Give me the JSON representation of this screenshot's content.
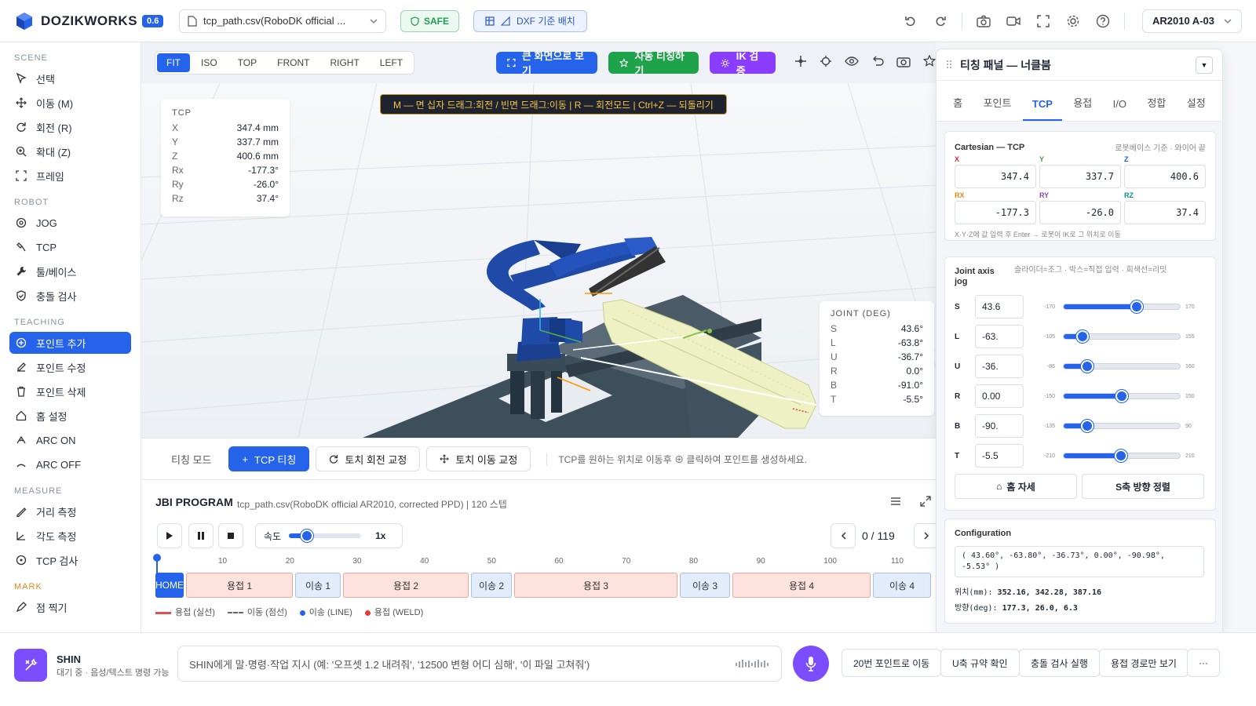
{
  "app": {
    "name": "DOZIKWORKS",
    "version": "0.6"
  },
  "topbar": {
    "file_name": "tcp_path.csv(RoboDK official ...",
    "safe_label": "SAFE",
    "dxf_label": "DXF 기준 배치",
    "robot_selector": "AR2010 A-03"
  },
  "sidebar": {
    "scene_title": "SCENE",
    "scene_items": [
      "선택",
      "이동 (M)",
      "회전 (R)",
      "확대 (Z)",
      "프레임"
    ],
    "robot_title": "ROBOT",
    "robot_items": [
      "JOG",
      "TCP",
      "툴/베이스",
      "충돌 검사"
    ],
    "teaching_title": "TEACHING",
    "teaching_items": [
      "포인트 추가",
      "포인트 수정",
      "포인트 삭제",
      "홈 설정",
      "ARC ON",
      "ARC OFF"
    ],
    "measure_title": "MEASURE",
    "measure_items": [
      "거리 측정",
      "각도 측정",
      "TCP 검사"
    ],
    "mark_title": "MARK",
    "mark_items": [
      "점 찍기"
    ]
  },
  "viewport": {
    "views": [
      "FIT",
      "ISO",
      "TOP",
      "FRONT",
      "RIGHT",
      "LEFT"
    ],
    "fullscreen_label": "큰 화면으로 보기",
    "auto_teach_label": "자동 티칭하기",
    "ik_label": "IK 검증",
    "hint": "M — 면 십자 드래그:회전 / 빈면 드래그:이동 | R — 회전모드 | Ctrl+Z — 되돌리기",
    "tcp_title": "TCP",
    "tcp": [
      {
        "k": "X",
        "v": "347.4 mm"
      },
      {
        "k": "Y",
        "v": "337.7 mm"
      },
      {
        "k": "Z",
        "v": "400.6 mm"
      },
      {
        "k": "Rx",
        "v": "-177.3°"
      },
      {
        "k": "Ry",
        "v": "-26.0°"
      },
      {
        "k": "Rz",
        "v": "37.4°"
      }
    ],
    "joint_title": "JOINT (DEG)",
    "joints": [
      {
        "k": "S",
        "v": "43.6°"
      },
      {
        "k": "L",
        "v": "-63.8°"
      },
      {
        "k": "U",
        "v": "-36.7°"
      },
      {
        "k": "R",
        "v": "0.0°"
      },
      {
        "k": "B",
        "v": "-91.0°"
      },
      {
        "k": "T",
        "v": "-5.5°"
      }
    ]
  },
  "teaching_mode": {
    "label": "티칭 모드",
    "tcp_teach": "TCP 티칭",
    "rot_fix": "토치 회전 교정",
    "move_fix": "토치 이동 교정",
    "hint": "TCP를 원하는 위치로 이동후 ⊕ 클릭하여 포인트를 생성하세요."
  },
  "program": {
    "title": "JBI PROGRAM",
    "subtitle": "tcp_path.csv(RoboDK official AR2010, corrected PPD) | 120 스텝",
    "speed_label": "속도",
    "speed_value": "1x",
    "speed_fraction": 0.25,
    "counter": "0 / 119",
    "ticks": [
      "10",
      "20",
      "30",
      "40",
      "50",
      "60",
      "70",
      "80",
      "90",
      "100",
      "110"
    ],
    "segments": [
      {
        "label": "HOME",
        "kind": "home"
      },
      {
        "label": "용접 1",
        "kind": "weld"
      },
      {
        "label": "이송 1",
        "kind": "move"
      },
      {
        "label": "용접 2",
        "kind": "weld"
      },
      {
        "label": "이송 2",
        "kind": "move"
      },
      {
        "label": "용접 3",
        "kind": "weld"
      },
      {
        "label": "이송 3",
        "kind": "move"
      },
      {
        "label": "용접 4",
        "kind": "weld"
      },
      {
        "label": "이송 4",
        "kind": "move"
      }
    ],
    "legend": [
      "용접 (실선)",
      "이동 (점선)",
      "이송 (LINE)",
      "용접 (WELD)"
    ]
  },
  "panel": {
    "title": "티칭 패널 — 너클붐",
    "tabs": [
      "홈",
      "포인트",
      "TCP",
      "용접",
      "I/O",
      "정합",
      "설정"
    ],
    "active_tab": "TCP",
    "cart_title": "Cartesian — TCP",
    "cart_note": "로봇베이스 기준 · 와이어 끝",
    "cart": [
      {
        "k": "X",
        "v": "347.4",
        "c": "#d32f2f"
      },
      {
        "k": "Y",
        "v": "337.7",
        "c": "#43a047"
      },
      {
        "k": "Z",
        "v": "400.6",
        "c": "#1e63d6"
      },
      {
        "k": "RX",
        "v": "-177.3",
        "c": "#e08a1e"
      },
      {
        "k": "RY",
        "v": "-26.0",
        "c": "#8e44ad"
      },
      {
        "k": "RZ",
        "v": "37.4",
        "c": "#0f8a8a"
      }
    ],
    "cart_help": "X·Y·Z에 값 입력 후 Enter → 로봇이 IK로 그 위치로 이동",
    "jog_title": "Joint axis jog",
    "jog_note": "슬라이더=조그 · 박스=직접 입력 · 회색선=리밋",
    "jog": [
      {
        "k": "S",
        "v": "43.6",
        "min": "-170",
        "max": "170",
        "frac": 0.63
      },
      {
        "k": "L",
        "v": "-63.",
        "min": "-105",
        "max": "155",
        "frac": 0.16
      },
      {
        "k": "U",
        "v": "-36.",
        "min": "-86",
        "max": "160",
        "frac": 0.2
      },
      {
        "k": "R",
        "v": "0.00",
        "min": "-150",
        "max": "150",
        "frac": 0.5
      },
      {
        "k": "B",
        "v": "-90.",
        "min": "-135",
        "max": "90",
        "frac": 0.2
      },
      {
        "k": "T",
        "v": "-5.5",
        "min": "-210",
        "max": "210",
        "frac": 0.49
      }
    ],
    "home_pose": "홈 자세",
    "s_axis_align": "S축 방향 정렬",
    "config_title": "Configuration",
    "config_value": "( 43.60°, -63.80°, -36.73°, 0.00°, -90.98°, -5.53° )",
    "pos_label": "위치(mm):",
    "pos_value": "352.16, 342.28, 387.16",
    "dir_label": "방향(deg):",
    "dir_value": "177.3, 26.0, 6.3"
  },
  "assistant": {
    "name": "SHIN",
    "status": "대기 중 · 음성/텍스트 명령 가능",
    "placeholder": "SHIN에게 말·명령·작업 지시 (예: '오프셋 1.2 내려줘', '12500 변형 어디 심해', '이 파일 고쳐줘')",
    "quick": [
      "20번 포인트로 이동",
      "U축 규약 확인",
      "충돌 검사 실행",
      "용접 경로만 보기",
      "···"
    ]
  },
  "colors": {
    "primary": "#2563eb",
    "green": "#1fa34a",
    "purple": "#8b3dff",
    "assistant": "#7c4dff"
  }
}
